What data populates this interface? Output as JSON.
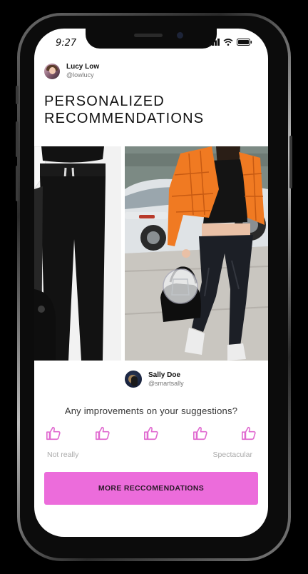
{
  "status_bar": {
    "time": "9:27"
  },
  "author": {
    "name": "Lucy Low",
    "handle": "@lowlucy"
  },
  "page": {
    "title": "PERSONALIZED RECOMMENDATIONS"
  },
  "stylist": {
    "name": "Sally Doe",
    "handle": "@smartsally"
  },
  "feedback": {
    "question": "Any improvements on your suggestions?",
    "rating_count": 5,
    "scale_low_label": "Not really",
    "scale_high_label": "Spectacular"
  },
  "cta": {
    "label": "MORE RECCOMENDATIONS"
  },
  "colors": {
    "accent": "#ec6cdb",
    "thumb_icon": "#e06ad0",
    "jacket": "#f07a22"
  }
}
